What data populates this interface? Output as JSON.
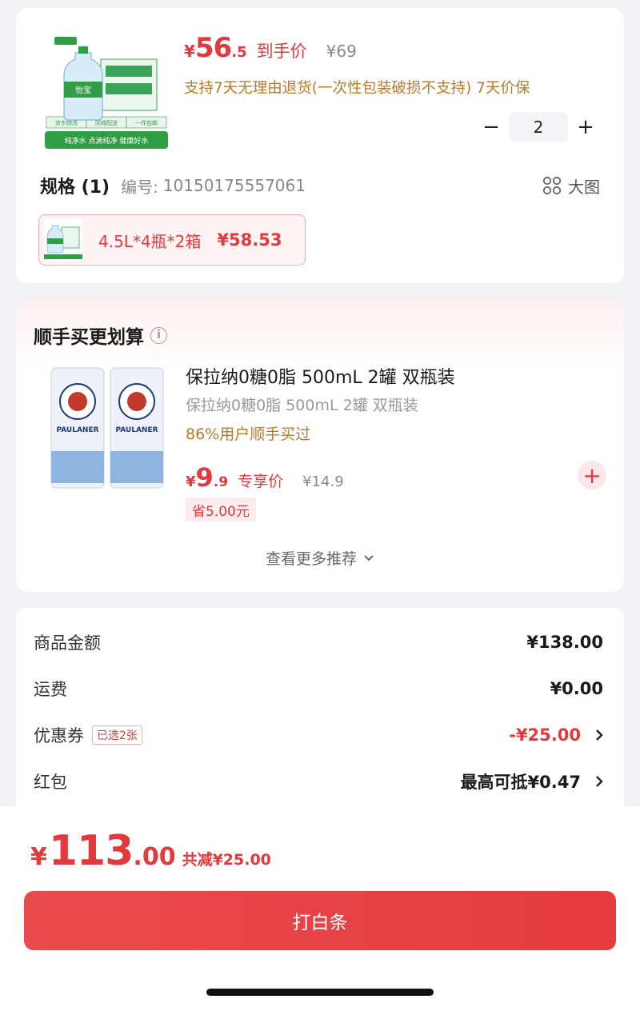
{
  "product": {
    "price_symbol": "¥",
    "price_int": "56",
    "price_dec": ".5",
    "price_tag": "到手价",
    "original_price": "¥69",
    "promise": "支持7天无理由退货(一次性包装破损不支持)  7天价保",
    "quantity": "2",
    "minus": "−",
    "plus": "+",
    "image_text": {
      "brand": "怡宝",
      "b1": "京东物流",
      "b2": "同城配送",
      "b3": "一件包邮",
      "slogan": "纯净水 点滴纯净 健康好水"
    }
  },
  "spec": {
    "title": "规格 (1)",
    "code_label": "编号:",
    "code": "10150175557061",
    "big_image": "大图",
    "option_label": "4.5L*4瓶*2箱",
    "option_price": "¥58.53"
  },
  "recommend": {
    "title": "顺手买更划算",
    "info": "i",
    "name": "保拉纳0糖0脂 500mL 2罐 双瓶装",
    "subtitle": "保拉纳0糖0脂 500mL 2罐 双瓶装",
    "bought": "86%用户顺手买过",
    "price_symbol": "¥",
    "price_int": "9",
    "price_dec": ".9",
    "price_tag": "专享价",
    "original_price": "¥14.9",
    "save": "省5.00元",
    "add": "+",
    "more": "查看更多推荐",
    "can_text": "PAULANER"
  },
  "summary": {
    "goods_label": "商品金额",
    "goods_value": "¥138.00",
    "shipping_label": "运费",
    "shipping_value": "¥0.00",
    "coupon_label": "优惠券",
    "coupon_badge": "已选2张",
    "coupon_value": "-¥25.00",
    "redpacket_label": "红包",
    "redpacket_value": "最高可抵¥0.47"
  },
  "checkout": {
    "total_symbol": "¥",
    "total_int": "113",
    "total_dec": ".00",
    "saved": "共减¥25.00",
    "button": "打白条"
  },
  "colors": {
    "accent": "#e4393c",
    "promise": "#b87a2c"
  }
}
